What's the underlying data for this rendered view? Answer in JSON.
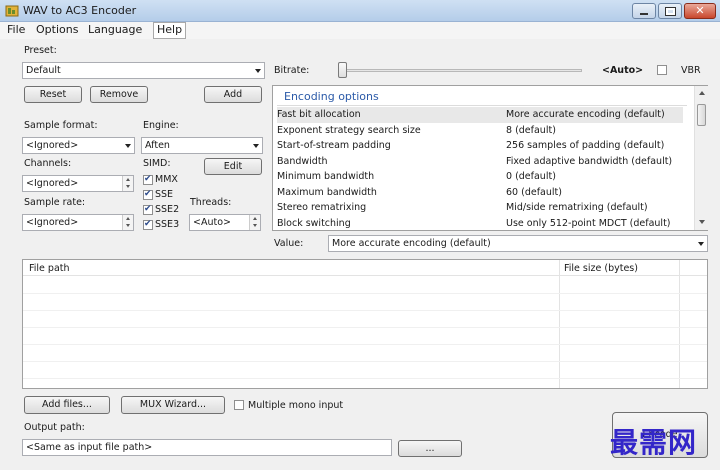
{
  "window": {
    "title": "WAV to AC3 Encoder"
  },
  "menu": {
    "items": [
      "File",
      "Options",
      "Language",
      "Help"
    ]
  },
  "preset": {
    "label": "Preset:",
    "value": "Default",
    "reset": "Reset",
    "remove": "Remove",
    "add": "Add"
  },
  "bitrate": {
    "label": "Bitrate:",
    "value": "<Auto>",
    "vbr_label": "VBR",
    "slider_level": 0
  },
  "sample_format": {
    "label": "Sample format:",
    "value": "<Ignored>"
  },
  "engine": {
    "label": "Engine:",
    "value": "Aften"
  },
  "channels": {
    "label": "Channels:",
    "value": "<Ignored>"
  },
  "simd": {
    "label": "SIMD:",
    "edit": "Edit",
    "options": [
      {
        "name": "MMX",
        "checked": true
      },
      {
        "name": "SSE",
        "checked": true
      },
      {
        "name": "SSE2",
        "checked": true
      },
      {
        "name": "SSE3",
        "checked": true
      }
    ]
  },
  "sample_rate": {
    "label": "Sample rate:",
    "value": "<Ignored>"
  },
  "threads": {
    "label": "Threads:",
    "value": "<Auto>"
  },
  "encoding": {
    "header": "Encoding options",
    "rows": [
      {
        "name": "Fast bit allocation",
        "value": "More accurate encoding (default)"
      },
      {
        "name": "Exponent strategy search size",
        "value": "8 (default)"
      },
      {
        "name": "Start-of-stream padding",
        "value": "256 samples of padding (default)"
      },
      {
        "name": "Bandwidth",
        "value": "Fixed adaptive bandwidth (default)"
      },
      {
        "name": "Minimum bandwidth",
        "value": "0 (default)"
      },
      {
        "name": "Maximum bandwidth",
        "value": "60 (default)"
      },
      {
        "name": "Stereo rematrixing",
        "value": "Mid/side rematrixing (default)"
      },
      {
        "name": "Block switching",
        "value": "Use only 512-point MDCT (default)"
      }
    ],
    "value_label": "Value:",
    "value_selected": "More accurate encoding (default)"
  },
  "files": {
    "col_path": "File path",
    "col_size": "File size (bytes)"
  },
  "actions": {
    "add_files": "Add files...",
    "mux_wizard": "MUX Wizard...",
    "multiple_mono": "Multiple mono input"
  },
  "output": {
    "label": "Output path:",
    "value": "<Same as input file path>",
    "browse": "...",
    "encode": "Encode"
  },
  "watermark": "最需网",
  "colors": {
    "title_bar": "#b4cde9",
    "section_header": "#2b5aa8",
    "close_button": "#c9462c",
    "watermark": "#3326c9"
  }
}
